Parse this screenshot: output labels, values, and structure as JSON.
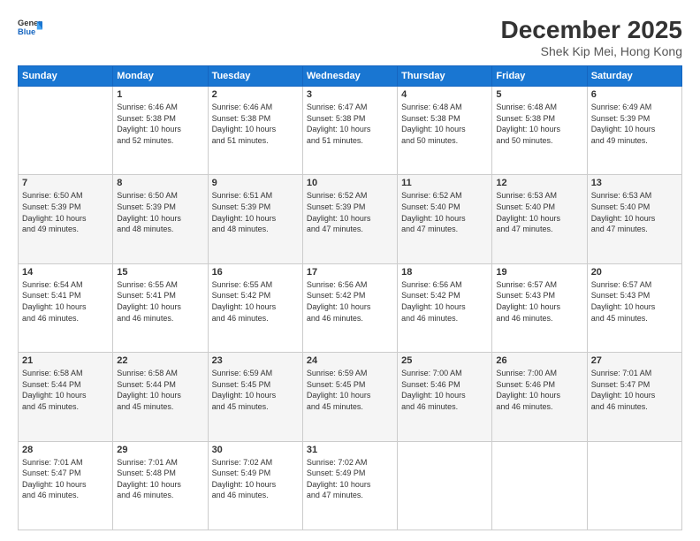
{
  "header": {
    "logo_line1": "General",
    "logo_line2": "Blue",
    "title": "December 2025",
    "subtitle": "Shek Kip Mei, Hong Kong"
  },
  "days_of_week": [
    "Sunday",
    "Monday",
    "Tuesday",
    "Wednesday",
    "Thursday",
    "Friday",
    "Saturday"
  ],
  "weeks": [
    [
      {
        "day": "",
        "info": ""
      },
      {
        "day": "1",
        "info": "Sunrise: 6:46 AM\nSunset: 5:38 PM\nDaylight: 10 hours\nand 52 minutes."
      },
      {
        "day": "2",
        "info": "Sunrise: 6:46 AM\nSunset: 5:38 PM\nDaylight: 10 hours\nand 51 minutes."
      },
      {
        "day": "3",
        "info": "Sunrise: 6:47 AM\nSunset: 5:38 PM\nDaylight: 10 hours\nand 51 minutes."
      },
      {
        "day": "4",
        "info": "Sunrise: 6:48 AM\nSunset: 5:38 PM\nDaylight: 10 hours\nand 50 minutes."
      },
      {
        "day": "5",
        "info": "Sunrise: 6:48 AM\nSunset: 5:38 PM\nDaylight: 10 hours\nand 50 minutes."
      },
      {
        "day": "6",
        "info": "Sunrise: 6:49 AM\nSunset: 5:39 PM\nDaylight: 10 hours\nand 49 minutes."
      }
    ],
    [
      {
        "day": "7",
        "info": "Sunrise: 6:50 AM\nSunset: 5:39 PM\nDaylight: 10 hours\nand 49 minutes."
      },
      {
        "day": "8",
        "info": "Sunrise: 6:50 AM\nSunset: 5:39 PM\nDaylight: 10 hours\nand 48 minutes."
      },
      {
        "day": "9",
        "info": "Sunrise: 6:51 AM\nSunset: 5:39 PM\nDaylight: 10 hours\nand 48 minutes."
      },
      {
        "day": "10",
        "info": "Sunrise: 6:52 AM\nSunset: 5:39 PM\nDaylight: 10 hours\nand 47 minutes."
      },
      {
        "day": "11",
        "info": "Sunrise: 6:52 AM\nSunset: 5:40 PM\nDaylight: 10 hours\nand 47 minutes."
      },
      {
        "day": "12",
        "info": "Sunrise: 6:53 AM\nSunset: 5:40 PM\nDaylight: 10 hours\nand 47 minutes."
      },
      {
        "day": "13",
        "info": "Sunrise: 6:53 AM\nSunset: 5:40 PM\nDaylight: 10 hours\nand 47 minutes."
      }
    ],
    [
      {
        "day": "14",
        "info": "Sunrise: 6:54 AM\nSunset: 5:41 PM\nDaylight: 10 hours\nand 46 minutes."
      },
      {
        "day": "15",
        "info": "Sunrise: 6:55 AM\nSunset: 5:41 PM\nDaylight: 10 hours\nand 46 minutes."
      },
      {
        "day": "16",
        "info": "Sunrise: 6:55 AM\nSunset: 5:42 PM\nDaylight: 10 hours\nand 46 minutes."
      },
      {
        "day": "17",
        "info": "Sunrise: 6:56 AM\nSunset: 5:42 PM\nDaylight: 10 hours\nand 46 minutes."
      },
      {
        "day": "18",
        "info": "Sunrise: 6:56 AM\nSunset: 5:42 PM\nDaylight: 10 hours\nand 46 minutes."
      },
      {
        "day": "19",
        "info": "Sunrise: 6:57 AM\nSunset: 5:43 PM\nDaylight: 10 hours\nand 46 minutes."
      },
      {
        "day": "20",
        "info": "Sunrise: 6:57 AM\nSunset: 5:43 PM\nDaylight: 10 hours\nand 45 minutes."
      }
    ],
    [
      {
        "day": "21",
        "info": "Sunrise: 6:58 AM\nSunset: 5:44 PM\nDaylight: 10 hours\nand 45 minutes."
      },
      {
        "day": "22",
        "info": "Sunrise: 6:58 AM\nSunset: 5:44 PM\nDaylight: 10 hours\nand 45 minutes."
      },
      {
        "day": "23",
        "info": "Sunrise: 6:59 AM\nSunset: 5:45 PM\nDaylight: 10 hours\nand 45 minutes."
      },
      {
        "day": "24",
        "info": "Sunrise: 6:59 AM\nSunset: 5:45 PM\nDaylight: 10 hours\nand 45 minutes."
      },
      {
        "day": "25",
        "info": "Sunrise: 7:00 AM\nSunset: 5:46 PM\nDaylight: 10 hours\nand 46 minutes."
      },
      {
        "day": "26",
        "info": "Sunrise: 7:00 AM\nSunset: 5:46 PM\nDaylight: 10 hours\nand 46 minutes."
      },
      {
        "day": "27",
        "info": "Sunrise: 7:01 AM\nSunset: 5:47 PM\nDaylight: 10 hours\nand 46 minutes."
      }
    ],
    [
      {
        "day": "28",
        "info": "Sunrise: 7:01 AM\nSunset: 5:47 PM\nDaylight: 10 hours\nand 46 minutes."
      },
      {
        "day": "29",
        "info": "Sunrise: 7:01 AM\nSunset: 5:48 PM\nDaylight: 10 hours\nand 46 minutes."
      },
      {
        "day": "30",
        "info": "Sunrise: 7:02 AM\nSunset: 5:49 PM\nDaylight: 10 hours\nand 46 minutes."
      },
      {
        "day": "31",
        "info": "Sunrise: 7:02 AM\nSunset: 5:49 PM\nDaylight: 10 hours\nand 47 minutes."
      },
      {
        "day": "",
        "info": ""
      },
      {
        "day": "",
        "info": ""
      },
      {
        "day": "",
        "info": ""
      }
    ]
  ]
}
